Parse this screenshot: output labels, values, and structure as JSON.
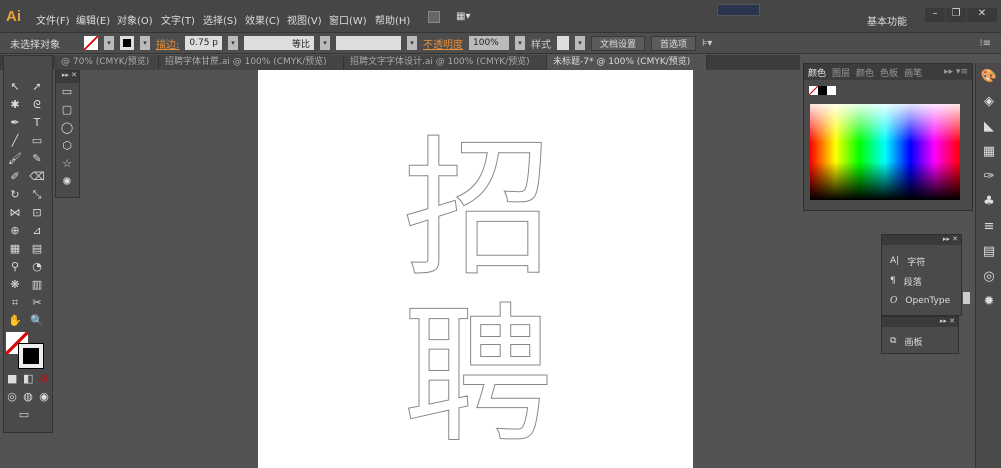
{
  "menubar": {
    "logo": "Ai",
    "items": [
      "文件(F)",
      "编辑(E)",
      "对象(O)",
      "文字(T)",
      "选择(S)",
      "效果(C)",
      "视图(V)",
      "窗口(W)",
      "帮助(H)"
    ],
    "workspace": "基本功能"
  },
  "control": {
    "selection": "未选择对象",
    "stroke_label": "描边:",
    "stroke_value": "0.75 p",
    "profile": "等比",
    "opacity_label": "不透明度",
    "opacity_value": "100%",
    "style_label": "样式",
    "doc_setup": "文档设置",
    "prefs": "首选项"
  },
  "tabs": [
    "@ 70% (CMYK/预览)",
    "招聘字体甘蔗.ai @ 100% (CMYK/预览)",
    "招聘文字字体设计.ai @ 100% (CMYK/预览)",
    "未标题-7* @ 100% (CMYK/预览)"
  ],
  "canvas": {
    "char1": "招",
    "char2": "聘"
  },
  "color_panel": {
    "tabs": [
      "颜色",
      "图层",
      "颜色",
      "色板",
      "画笔"
    ]
  },
  "char_panel": {
    "items": [
      "字符",
      "段落",
      "OpenType"
    ]
  },
  "artboard_panel": {
    "label": "画板"
  }
}
